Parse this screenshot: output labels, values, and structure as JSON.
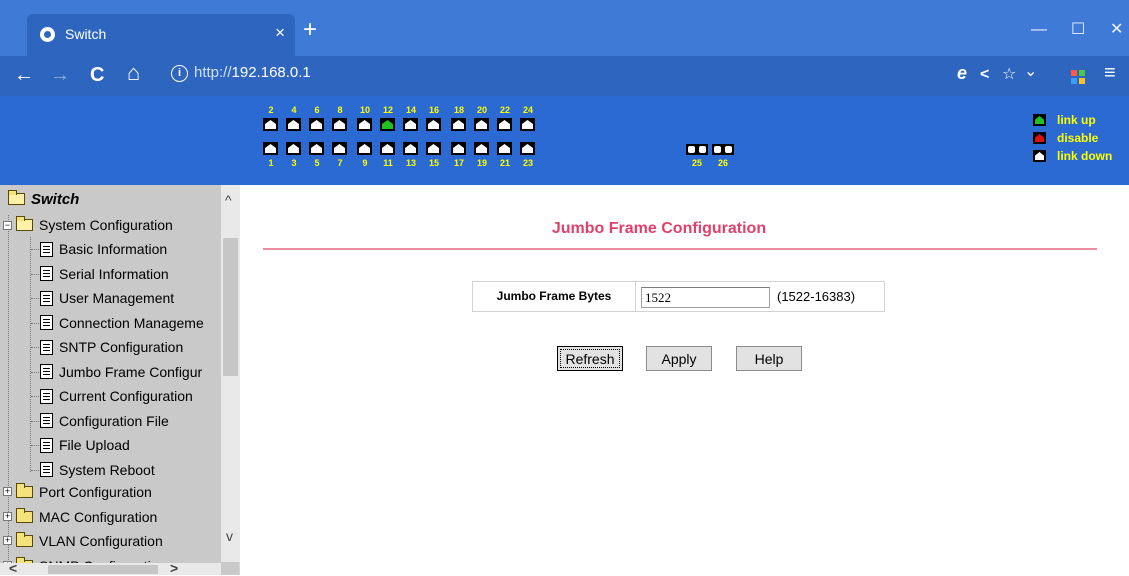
{
  "browser": {
    "tab_title": "Switch",
    "tab_close": "×",
    "new_tab": "+",
    "url_scheme": "http://",
    "url_host": "192.168.0.1",
    "info_icon": "i",
    "window_minimize": "—",
    "window_maximize": "☐",
    "window_close": "✕",
    "nav_back": "←",
    "nav_forward": "→",
    "nav_reload": "C",
    "nav_home": "⌂",
    "addr_ie": "e",
    "addr_share": "<",
    "addr_star": "☆",
    "addr_dropdown": "⌄",
    "addr_menu": "≡",
    "icons": [
      "favicon-icon",
      "info-icon",
      "ie-mode-icon",
      "share-icon",
      "star-icon",
      "dropdown-icon",
      "extensions-icon",
      "menu-icon"
    ]
  },
  "ports": {
    "top_numbers": [
      "2",
      "4",
      "6",
      "8",
      "10",
      "12",
      "14",
      "16",
      "18",
      "20",
      "22",
      "24"
    ],
    "bottom_numbers": [
      "1",
      "3",
      "5",
      "7",
      "9",
      "11",
      "13",
      "15",
      "17",
      "19",
      "21",
      "23"
    ],
    "combo_numbers": [
      "25",
      "26"
    ],
    "top_status": [
      "down",
      "down",
      "down",
      "down",
      "down",
      "up",
      "down",
      "down",
      "down",
      "down",
      "down",
      "down"
    ],
    "bottom_status": [
      "down",
      "down",
      "down",
      "down",
      "down",
      "down",
      "down",
      "down",
      "down",
      "down",
      "down",
      "down"
    ],
    "colors": {
      "up": "#22c022",
      "disabled": "#e01010",
      "down": "#ffffff",
      "label": "#ffff00"
    },
    "legend": [
      {
        "label": "link up",
        "status": "up"
      },
      {
        "label": "disable",
        "status": "disabled"
      },
      {
        "label": "link down",
        "status": "down"
      }
    ]
  },
  "sidebar": {
    "root": "Switch",
    "system_folder": "System Configuration",
    "system_items": [
      "Basic Information",
      "Serial Information",
      "User Management",
      "Connection Manageme",
      "SNTP Configuration",
      "Jumbo Frame Configur",
      "Current Configuration",
      "Configuration File",
      "File Upload",
      "System Reboot"
    ],
    "other_folders": [
      "Port Configuration",
      "MAC Configuration",
      "VLAN Configuration",
      "SNMP Configuration"
    ],
    "scroll_up": "^",
    "scroll_down": "v",
    "scroll_left": "<",
    "scroll_right": ">"
  },
  "main": {
    "title": "Jumbo Frame Configuration",
    "title_color": "#e0406a",
    "field_label": "Jumbo Frame Bytes",
    "field_value": "1522",
    "field_range": "(1522-16383)",
    "buttons": {
      "refresh": "Refresh",
      "apply": "Apply",
      "help": "Help"
    }
  }
}
